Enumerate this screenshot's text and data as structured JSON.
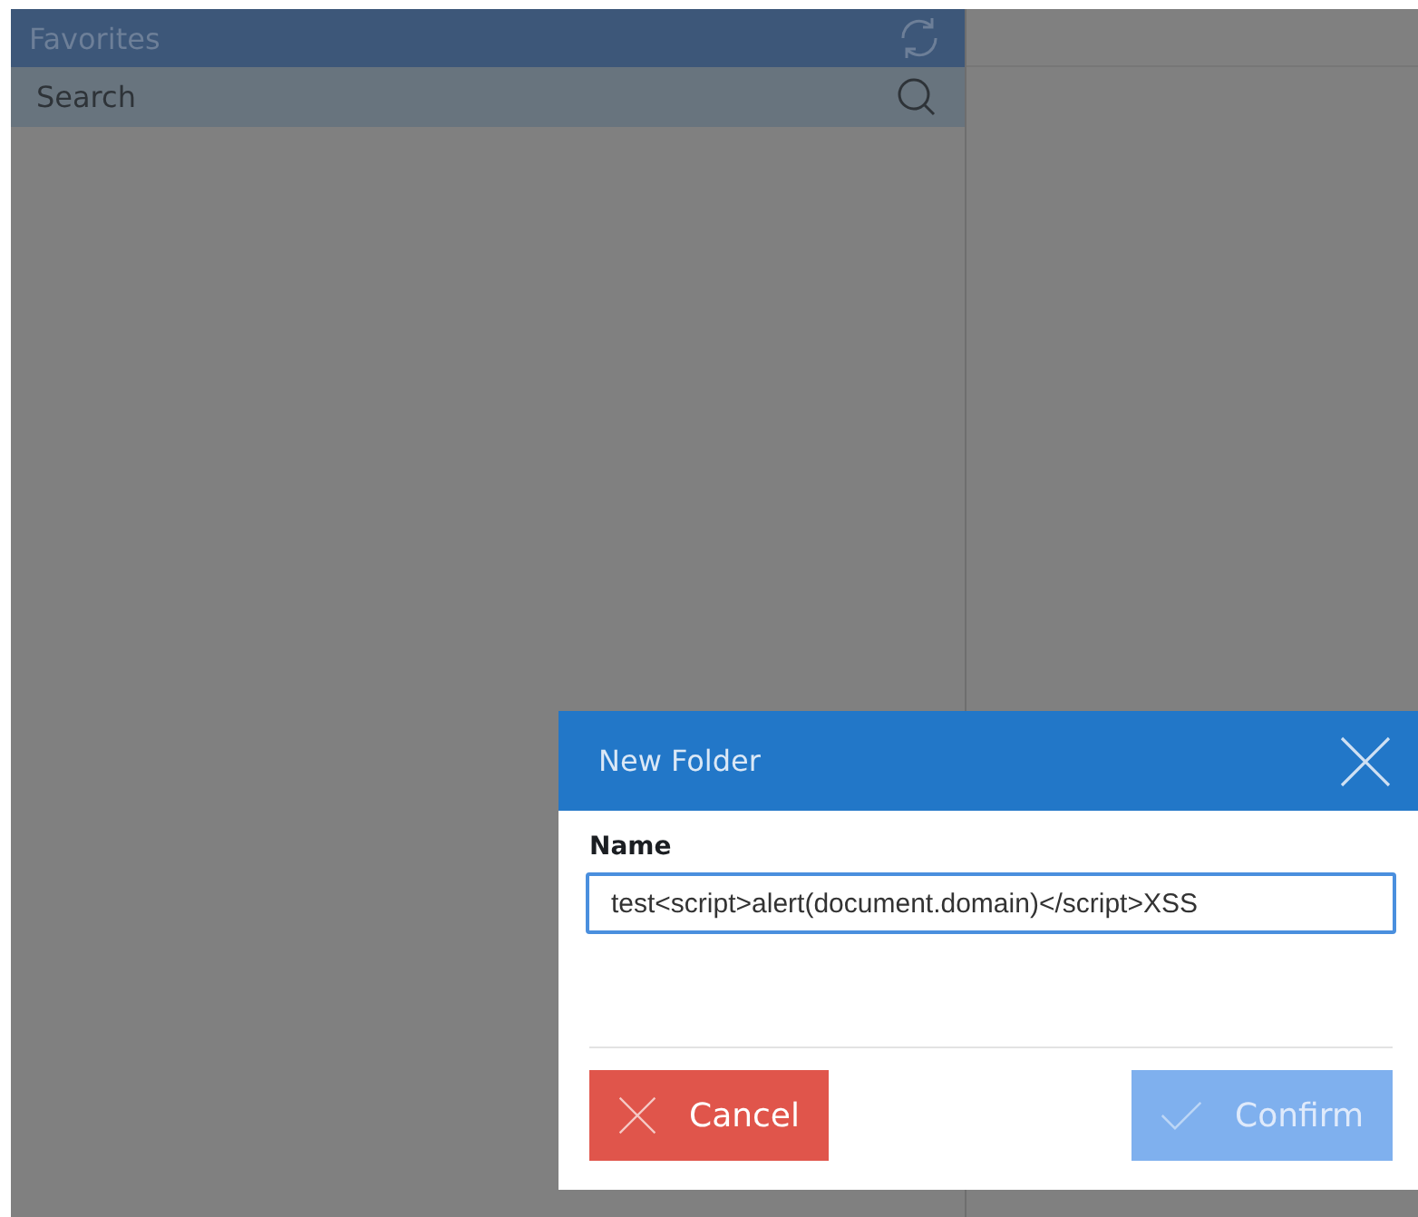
{
  "sidebar": {
    "title": "Favorites",
    "search": {
      "placeholder": "Search"
    }
  },
  "dialog": {
    "title": "New Folder",
    "field": {
      "label": "Name",
      "value": "test<script>alert(document.domain)</script>XSS",
      "focused": true
    },
    "buttons": [
      {
        "kind": "cancel",
        "label": "Cancel",
        "disabled": false
      },
      {
        "kind": "confirm",
        "label": "Confirm",
        "disabled": true
      }
    ]
  }
}
